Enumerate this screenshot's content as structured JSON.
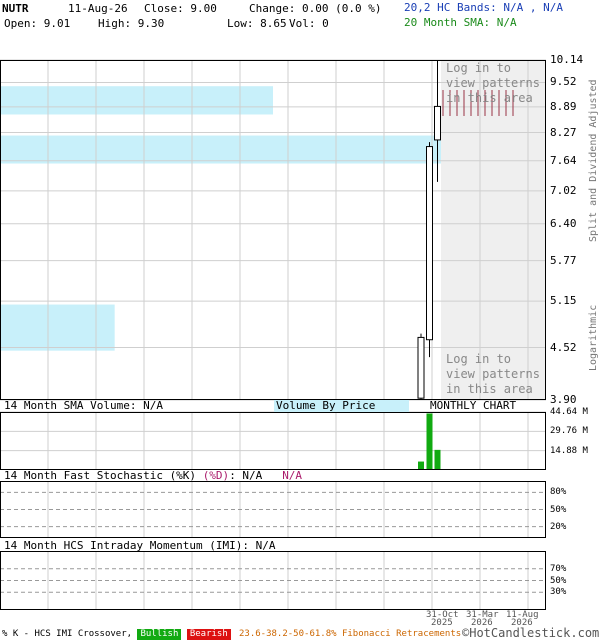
{
  "header": {
    "symbol": "NUTR",
    "date": "11-Aug-26",
    "close": "Close: 9.00",
    "change": "Change: 0.00 (0.0 %)",
    "open": "Open: 9.01",
    "high": "High: 9.30",
    "low": "Low: 8.65",
    "vol": "Vol: 0",
    "hc_bands": "20,2 HC Bands: N/A , N/A",
    "sma": "20 Month SMA: N/A"
  },
  "colors": {
    "hc_bands": "#1a3fb5",
    "sma": "#1a8a1a",
    "volume_bars": "#11aa11",
    "price_zone": "#c8f0fa",
    "pattern_marks": "#993344",
    "stoch_d": "#aa1a6a",
    "bullish": "#11aa11",
    "bearish": "#dd1111",
    "fib": "#cc6600",
    "grid": "#cfcfcf"
  },
  "axis": {
    "side_label_top": "Split and Dividend Adjusted",
    "side_label_bottom": "Logarithmic",
    "price_ticks": [
      "10.14",
      "9.52",
      "8.89",
      "8.27",
      "7.64",
      "7.02",
      "6.40",
      "5.77",
      "5.15",
      "4.52",
      "3.90"
    ],
    "volume_ticks": [
      "44.64 M",
      "29.76 M",
      "14.88 M"
    ],
    "stoch_ticks": [
      "80%",
      "50%",
      "20%"
    ],
    "imi_ticks": [
      "70%",
      "50%",
      "30%"
    ],
    "date_ticks": [
      {
        "top": "31-Oct",
        "bottom": "2025"
      },
      {
        "top": "31-Mar",
        "bottom": "2026"
      },
      {
        "top": "11-Aug",
        "bottom": "2026"
      }
    ]
  },
  "overlay": {
    "login_top": "Log in to\nview patterns\nin this area",
    "login_bottom": "Log in to\nview patterns\nin this area"
  },
  "panels": {
    "volume_title": "14 Month SMA Volume: N/A",
    "volume_by_price": "Volume By Price",
    "monthly_chart": "MONTHLY CHART",
    "stoch_title_a": "14 Month Fast Stochastic (%K)",
    "stoch_title_b": "(%D)",
    "stoch_title_c": ": N/A",
    "stoch_title_d": "N/A",
    "imi_title": "14 Month HCS Intraday Momentum (IMI): N/A"
  },
  "footer": {
    "crossover": "% K - HCS IMI Crossover,",
    "bullish": "Bullish",
    "bearish": "Bearish",
    "fib": "23.6-38.2-50-61.8% Fibonacci Retracements",
    "copyright": "©HotCandlestick.com"
  },
  "chart_data": {
    "type": "candlestick",
    "interval": "monthly",
    "scale": "logarithmic",
    "ylim": [
      3.9,
      10.14
    ],
    "price_candles": [
      {
        "open": 3.92,
        "high": 4.7,
        "low": 3.9,
        "close": 4.65
      },
      {
        "open": 4.62,
        "high": 8.05,
        "low": 4.4,
        "close": 7.95
      },
      {
        "open": 8.1,
        "high": 10.14,
        "low": 7.2,
        "close": 8.9
      }
    ],
    "volume": {
      "unit": "M",
      "ylim": [
        0,
        44.64
      ],
      "values": [
        6.5,
        43.5,
        15.5
      ]
    },
    "volume_by_price_zones": [
      {
        "low": 8.7,
        "high": 9.42,
        "relative_volume": 0.5
      },
      {
        "low": 7.58,
        "high": 8.2,
        "relative_volume": 1.0
      },
      {
        "low": 4.48,
        "high": 5.1,
        "relative_volume": 0.21
      }
    ],
    "stochastic": {
      "k": null,
      "d": null,
      "levels": [
        80,
        50,
        20
      ]
    },
    "imi": {
      "value": null,
      "levels": [
        70,
        50,
        30
      ]
    }
  }
}
